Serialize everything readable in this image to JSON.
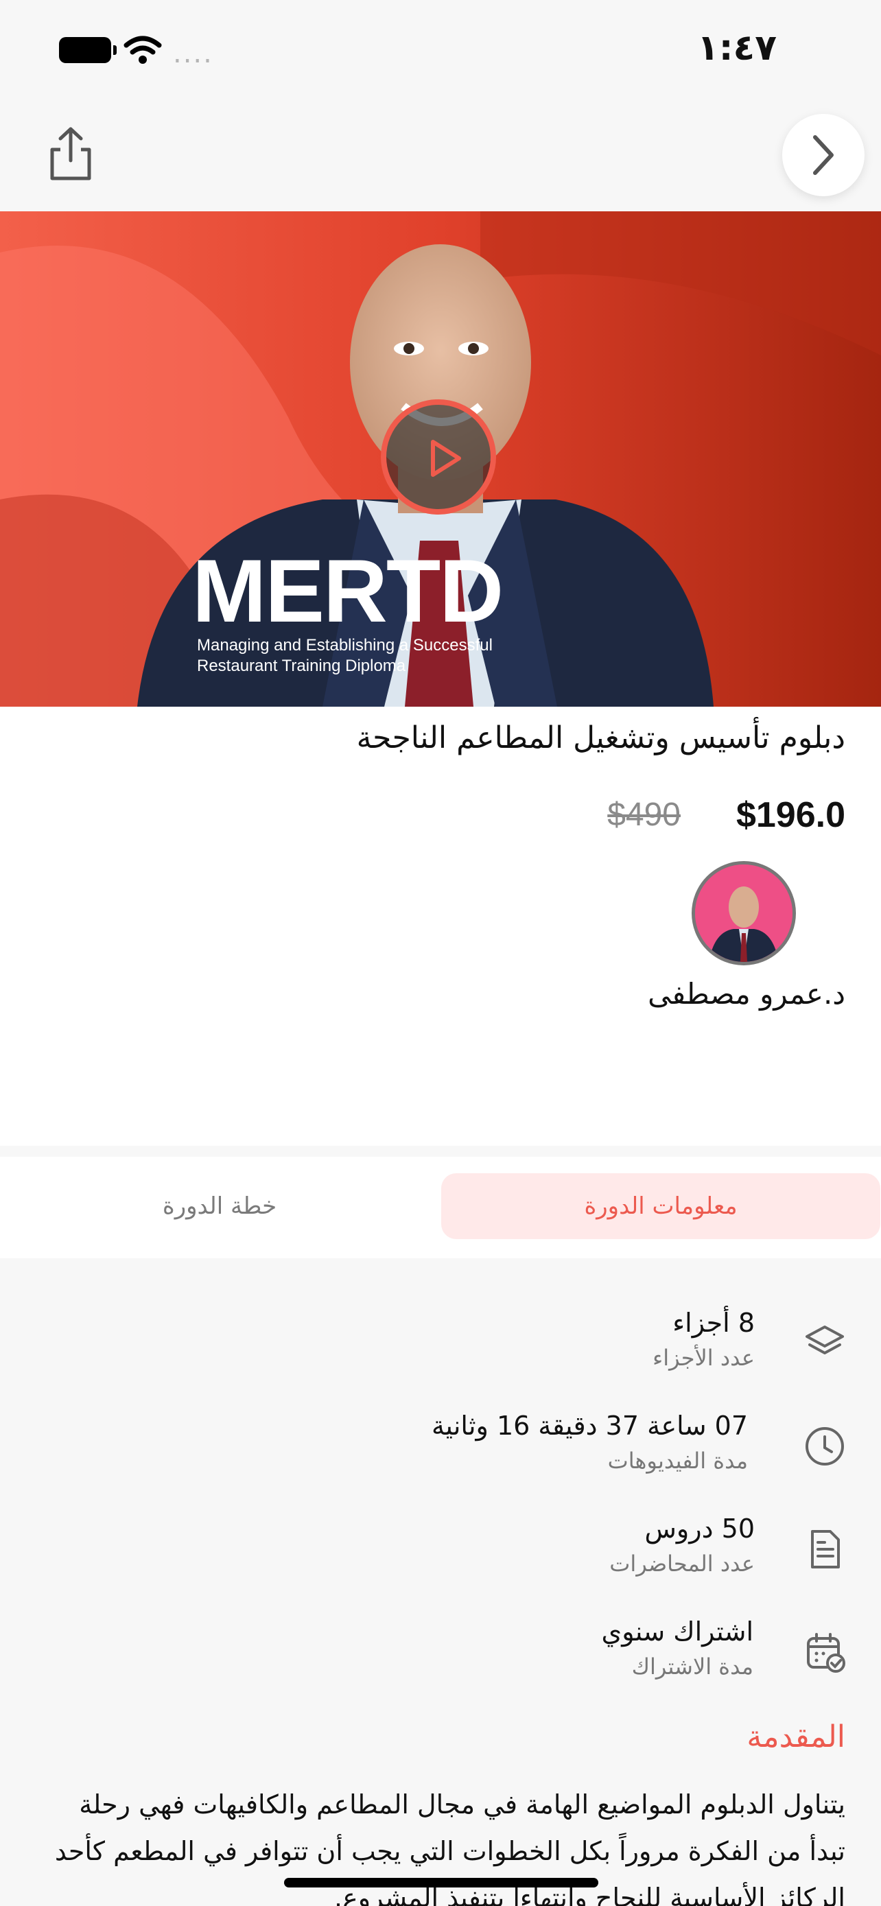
{
  "status_bar": {
    "time": "١:٤٧",
    "signal": "...."
  },
  "hero": {
    "title": "MERTD",
    "subtitle_line1": "Managing and Establishing a Successful",
    "subtitle_line2": "Restaurant Training Diploma"
  },
  "course": {
    "title": "دبلوم تأسيس وتشغيل المطاعم الناجحة",
    "price_current": "$196.0",
    "price_old": "$490",
    "instructor": "د.عمرو مصطفى"
  },
  "tabs": [
    {
      "label": "معلومات الدورة",
      "active": true
    },
    {
      "label": "خطة الدورة",
      "active": false
    }
  ],
  "stats": [
    {
      "value": "8 أجزاء",
      "label": "عدد الأجزاء",
      "icon": "layers-icon"
    },
    {
      "value": "07 ساعة 37 دقيقة 16 وثانية",
      "label": "مدة الفيديوهات",
      "icon": "clock-icon"
    },
    {
      "value": "50 دروس",
      "label": "عدد المحاضرات",
      "icon": "document-icon"
    },
    {
      "value": "اشتراك سنوي",
      "label": "مدة الاشتراك",
      "icon": "calendar-check-icon"
    }
  ],
  "intro": {
    "heading": "المقدمة",
    "text": "يتناول الدبلوم المواضيع الهامة في مجال المطاعم والكافيهات فهي رحلة تبدأ من الفكرة مروراً بكل الخطوات التي يجب أن تتوافر في المطعم كأحد الركائز الأساسية للنجاح وانتهاءاً بتنفيذ المشروع."
  },
  "colors": {
    "accent": "#ec5a4f",
    "tab_active_bg": "#ffe9e9",
    "hero_red": "#d2361f"
  }
}
